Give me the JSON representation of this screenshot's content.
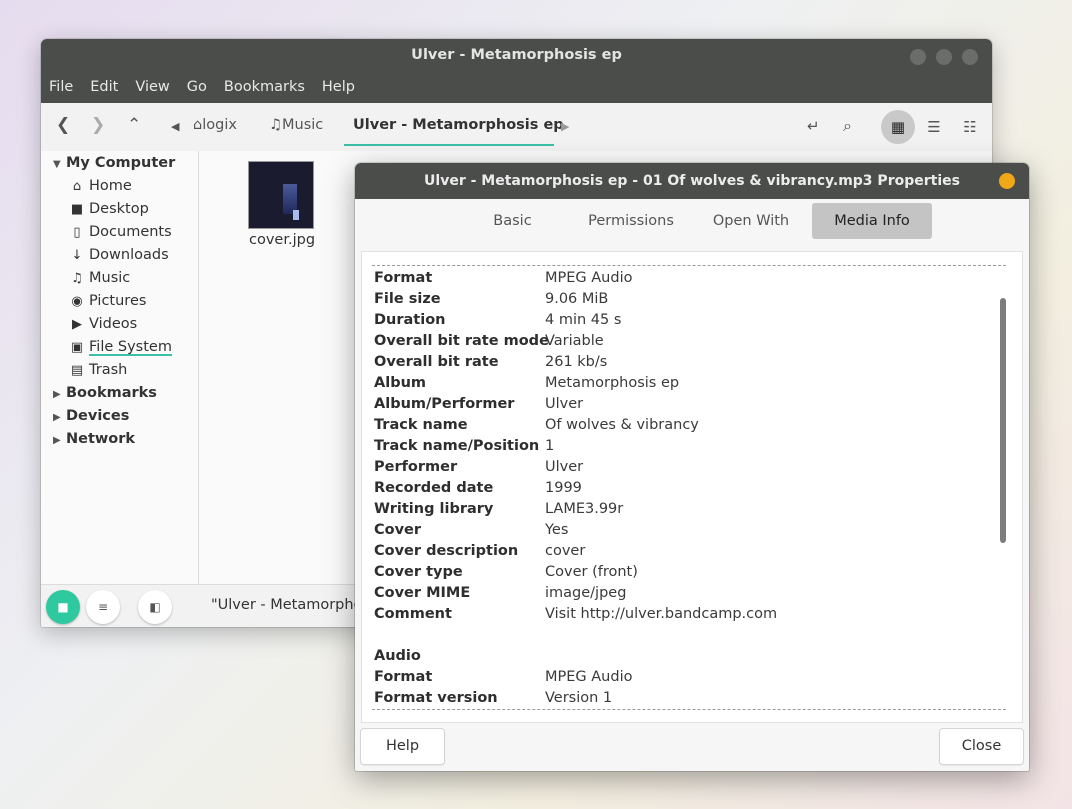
{
  "file_manager": {
    "title": "Ulver - Metamorphosis ep",
    "menu": [
      "File",
      "Edit",
      "View",
      "Go",
      "Bookmarks",
      "Help"
    ],
    "breadcrumbs": [
      "logix",
      "Music",
      "Ulver - Metamorphosis ep"
    ],
    "sidebar": {
      "my_computer": "My Computer",
      "items": [
        "Home",
        "Desktop",
        "Documents",
        "Downloads",
        "Music",
        "Pictures",
        "Videos",
        "File System",
        "Trash"
      ],
      "bookmarks": "Bookmarks",
      "devices": "Devices",
      "network": "Network"
    },
    "files": [
      {
        "name": "cover.jpg"
      }
    ],
    "status": "\"Ulver - Metamorphos"
  },
  "properties": {
    "title": "Ulver - Metamorphosis ep - 01 Of wolves & vibrancy.mp3 Properties",
    "tabs": [
      "Basic",
      "Permissions",
      "Open With",
      "Media Info"
    ],
    "active_tab": "Media Info",
    "rows": [
      {
        "k": "Format",
        "v": "MPEG Audio"
      },
      {
        "k": "File size",
        "v": "9.06 MiB"
      },
      {
        "k": "Duration",
        "v": "4 min 45 s"
      },
      {
        "k": "Overall bit rate mode",
        "v": "Variable"
      },
      {
        "k": "Overall bit rate",
        "v": "261 kb/s"
      },
      {
        "k": "Album",
        "v": "Metamorphosis ep"
      },
      {
        "k": "Album/Performer",
        "v": "Ulver"
      },
      {
        "k": "Track name",
        "v": "Of wolves & vibrancy"
      },
      {
        "k": "Track name/Position",
        "v": "1"
      },
      {
        "k": "Performer",
        "v": "Ulver"
      },
      {
        "k": "Recorded date",
        "v": "1999"
      },
      {
        "k": "Writing library",
        "v": "LAME3.99r"
      },
      {
        "k": "Cover",
        "v": "Yes"
      },
      {
        "k": "Cover description",
        "v": "cover"
      },
      {
        "k": "Cover type",
        "v": "Cover (front)"
      },
      {
        "k": "Cover MIME",
        "v": "image/jpeg"
      },
      {
        "k": "Comment",
        "v": "Visit http://ulver.bandcamp.com"
      },
      {
        "k": "",
        "v": ""
      },
      {
        "k": "Audio",
        "v": ""
      },
      {
        "k": "Format",
        "v": "MPEG Audio"
      },
      {
        "k": "Format version",
        "v": "Version 1"
      }
    ],
    "help_label": "Help",
    "close_label": "Close"
  },
  "colors": {
    "accent": "#3cbfa6",
    "titlebar": "#4a4d4a",
    "close_button": "#f0a818",
    "folder_button": "#2ec99f"
  }
}
